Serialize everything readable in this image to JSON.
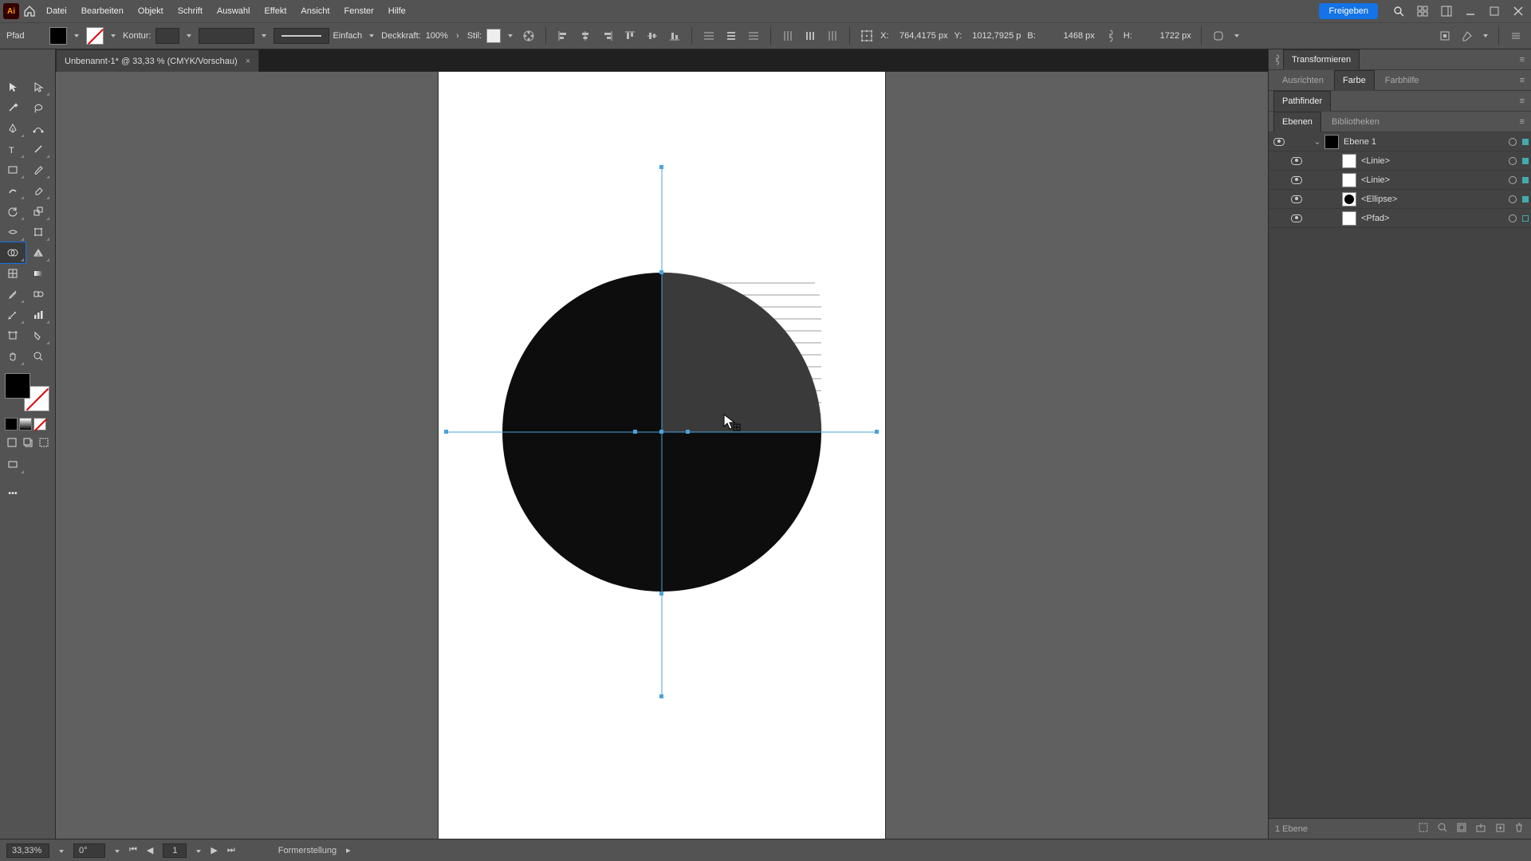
{
  "app": {
    "logo_text": "Ai"
  },
  "menu": {
    "items": [
      "Datei",
      "Bearbeiten",
      "Objekt",
      "Schrift",
      "Auswahl",
      "Effekt",
      "Ansicht",
      "Fenster",
      "Hilfe"
    ],
    "share": "Freigeben"
  },
  "control": {
    "selection_type": "Pfad",
    "kontur_label": "Kontur:",
    "kontur_value": "",
    "stroke_profile": "Einfach",
    "deckkraft_label": "Deckkraft:",
    "deckkraft_value": "100%",
    "stil_label": "Stil:",
    "x_label": "X:",
    "x_value": "764,4175 px",
    "y_label": "Y:",
    "y_value": "1012,7925 p",
    "w_label": "B:",
    "w_value": "1468 px",
    "h_label": "H:",
    "h_value": "1722 px"
  },
  "doc_tab": {
    "title": "Unbenannt-1* @ 33,33 % (CMYK/Vorschau)",
    "close": "×"
  },
  "panels": {
    "transform": "Transformieren",
    "ausrichten": "Ausrichten",
    "farbe": "Farbe",
    "farbhilfe": "Farbhilfe",
    "pathfinder": "Pathfinder",
    "ebenen": "Ebenen",
    "bibliotheken": "Bibliotheken"
  },
  "layers": {
    "layer1": "Ebene 1",
    "items": [
      {
        "name": "<Linie>",
        "thumb": "white"
      },
      {
        "name": "<Linie>",
        "thumb": "white"
      },
      {
        "name": "<Ellipse>",
        "thumb": "ellipse"
      },
      {
        "name": "<Pfad>",
        "thumb": "white"
      }
    ],
    "footer_count": "1 Ebene"
  },
  "status": {
    "zoom": "33,33%",
    "rotation": "0°",
    "artboard_index": "1",
    "tool": "Formerstellung"
  }
}
